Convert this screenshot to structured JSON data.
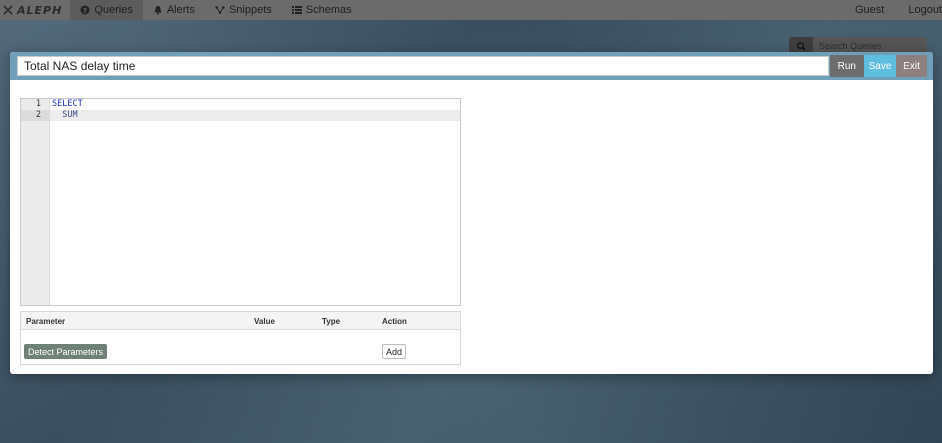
{
  "navbar": {
    "brand": "ALEPH",
    "items": [
      {
        "label": "Queries",
        "icon": "question-circle-icon",
        "active": true
      },
      {
        "label": "Alerts",
        "icon": "bell-icon",
        "active": false
      },
      {
        "label": "Snippets",
        "icon": "snippets-icon",
        "active": false
      },
      {
        "label": "Schemas",
        "icon": "list-icon",
        "active": false
      }
    ],
    "right": [
      "Guest",
      "Logout"
    ]
  },
  "background": {
    "search_placeholder": "Search Queries"
  },
  "modal": {
    "title_value": "Total NAS delay time",
    "buttons": {
      "run": "Run",
      "save": "Save",
      "exit": "Exit"
    },
    "editor": {
      "line_numbers": [
        "1",
        "2"
      ],
      "lines": [
        {
          "keyword": "SELECT",
          "text": ""
        },
        {
          "keyword": "",
          "text": "  SUM"
        }
      ]
    },
    "params": {
      "headers": {
        "parameter": "Parameter",
        "value": "Value",
        "type": "Type",
        "action": "Action"
      },
      "detect_label": "Detect Parameters",
      "add_label": "Add"
    }
  },
  "colors": {
    "navbar": "#6b6b6b",
    "modal_header": "#6f9fb9",
    "run": "#6d6d6d",
    "save": "#5fbde0",
    "exit": "#8d7f7f",
    "detect": "#6f8077"
  }
}
